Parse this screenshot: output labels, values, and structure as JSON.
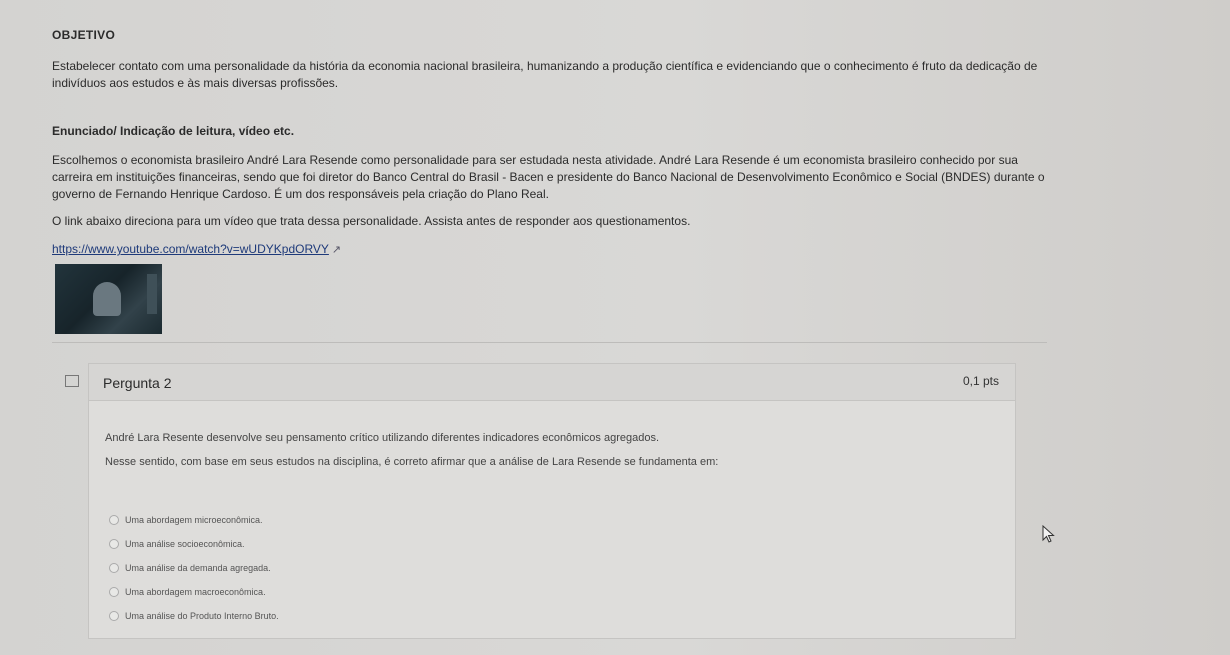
{
  "objective": {
    "heading": "OBJETIVO",
    "text": "Estabelecer contato com uma personalidade da história da economia nacional brasileira, humanizando a produção científica e evidenciando que o conhecimento é fruto da dedicação de indivíduos aos estudos e às mais diversas profissões."
  },
  "statement": {
    "heading": "Enunciado/ Indicação de leitura, vídeo etc.",
    "paragraph1": "Escolhemos o economista brasileiro André Lara Resende como personalidade para ser estudada nesta atividade. André Lara Resende é um economista brasileiro conhecido por sua carreira em instituições financeiras, sendo que foi diretor do Banco Central do Brasil - Bacen e presidente do Banco Nacional de Desenvolvimento Econômico e Social (BNDES) durante o governo de Fernando Henrique Cardoso. É um dos responsáveis pela criação do Plano Real.",
    "paragraph2": "O link abaixo direciona para um vídeo que trata dessa personalidade. Assista antes de responder aos questionamentos.",
    "link": "https://www.youtube.com/watch?v=wUDYKpdORVY",
    "external_icon": "↗"
  },
  "question": {
    "title": "Pergunta 2",
    "points": "0,1 pts",
    "text1": "André Lara Resente desenvolve seu pensamento crítico utilizando diferentes indicadores econômicos agregados.",
    "text2": "Nesse sentido, com base em seus estudos na disciplina, é correto afirmar que a análise de Lara Resende se fundamenta em:",
    "options": [
      "Uma abordagem microeconômica.",
      "Uma análise socioeconômica.",
      "Uma análise da demanda agregada.",
      "Uma abordagem macroeconômica.",
      "Uma análise do Produto Interno Bruto."
    ]
  }
}
